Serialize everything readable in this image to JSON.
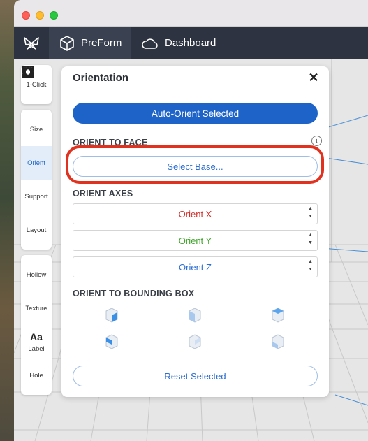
{
  "app": {
    "tabs": [
      {
        "label": "PreForm",
        "icon": "preform-cube-icon"
      },
      {
        "label": "Dashboard",
        "icon": "cloud-icon"
      }
    ]
  },
  "toolbar": {
    "groups": [
      [
        {
          "label": "1-Click",
          "icon": "magic-wand-icon"
        }
      ],
      [
        {
          "label": "Size",
          "icon": "size-icon"
        },
        {
          "label": "Orient",
          "icon": "orient-icon",
          "active": true
        },
        {
          "label": "Support",
          "icon": "support-icon"
        },
        {
          "label": "Layout",
          "icon": "layout-icon"
        }
      ],
      [
        {
          "label": "Hollow",
          "icon": "hollow-icon"
        },
        {
          "label": "Texture",
          "icon": "texture-icon"
        },
        {
          "label": "Label",
          "icon": "label-icon"
        },
        {
          "label": "Hole",
          "icon": "hole-icon"
        }
      ]
    ]
  },
  "panel": {
    "title": "Orientation",
    "close": "✕",
    "auto_orient": "Auto-Orient Selected",
    "orient_to_face": "ORIENT TO FACE",
    "info": "i",
    "select_base": "Select Base...",
    "orient_axes": "ORIENT AXES",
    "axes": [
      {
        "label": "Orient X",
        "color": "#d0312d"
      },
      {
        "label": "Orient Y",
        "color": "#3fa52b"
      },
      {
        "label": "Orient Z",
        "color": "#2e6ed0"
      }
    ],
    "orient_to_bounding_box": "ORIENT TO BOUNDING BOX",
    "reset": "Reset Selected"
  },
  "colors": {
    "accent": "#1e63c8",
    "highlight": "#e0321f",
    "appbar": "#2d3340"
  }
}
